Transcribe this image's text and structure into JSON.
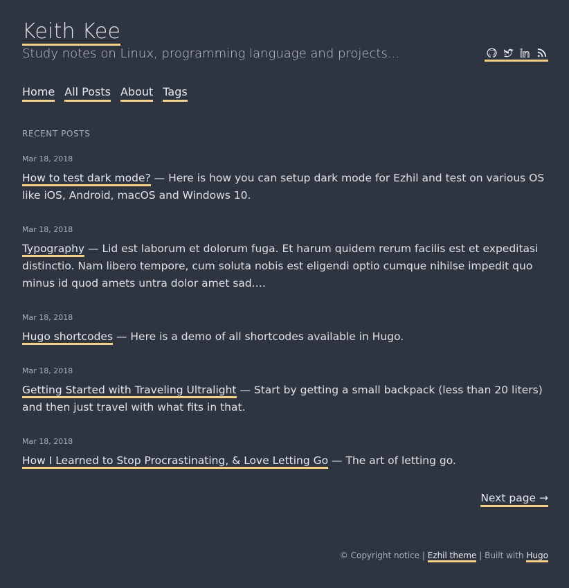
{
  "site": {
    "title": "Keith Kee",
    "subtitle": "Study notes on Linux, programming language and projects..."
  },
  "social": [
    "github-icon",
    "twitter-icon",
    "linkedin-icon",
    "rss-icon"
  ],
  "nav": [
    {
      "label": "Home"
    },
    {
      "label": "All Posts"
    },
    {
      "label": "About"
    },
    {
      "label": "Tags"
    }
  ],
  "section_title": "RECENT POSTS",
  "posts": [
    {
      "date": "Mar 18, 2018",
      "title": "How to test dark mode?",
      "summary": " — Here is how you can setup dark mode for Ezhil and test on various OS like iOS, Android, macOS and Windows 10."
    },
    {
      "date": "Mar 18, 2018",
      "title": "Typography",
      "summary": " — Lid est laborum et dolorum fuga. Et harum quidem rerum facilis est et expeditasi distinctio. Nam libero tempore, cum soluta nobis est eligendi optio cumque nihilse impedit quo minus id quod amets untra dolor amet sad.…"
    },
    {
      "date": "Mar 18, 2018",
      "title": "Hugo shortcodes",
      "summary": " — Here is a demo of all shortcodes available in Hugo."
    },
    {
      "date": "Mar 18, 2018",
      "title": "Getting Started with Traveling Ultralight",
      "summary": " — Start by getting a small backpack (less than 20 liters) and then just travel with what fits in that."
    },
    {
      "date": "Mar 18, 2018",
      "title": "How I Learned to Stop Procrastinating, & Love Letting Go",
      "summary": " — The art of letting go."
    }
  ],
  "pagination": {
    "next_label": "Next page →"
  },
  "footer": {
    "copyright": "© Copyright notice | ",
    "theme_link": "Ezhil theme",
    "built_with": " | Built with ",
    "hugo_link": "Hugo"
  },
  "colors": {
    "background": "#2e3440",
    "text": "#dee2e6",
    "accent_underline": "#f4cf86"
  }
}
